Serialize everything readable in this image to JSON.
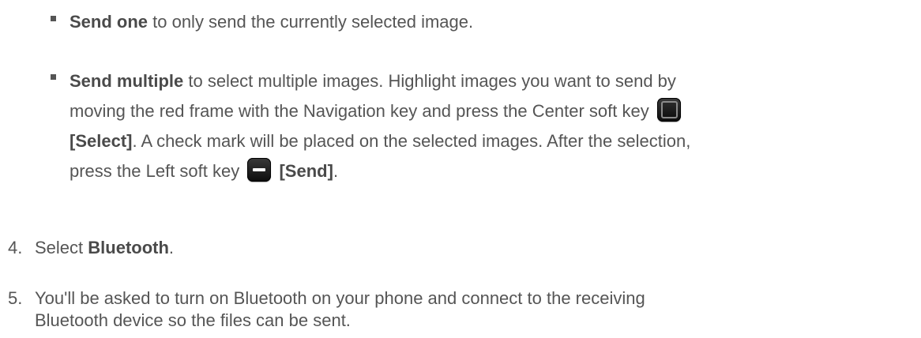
{
  "bullets": [
    {
      "bold": "Send one",
      "text": " to only send the currently selected image."
    },
    {
      "bold": "Send multiple",
      "line1": " to select multiple images. Highlight images you want to send by",
      "line2": "moving the red frame with the Navigation key and press the Center soft key",
      "select_label": "[Select]",
      "line3": ". A check mark will be placed on the selected images. After the selection,",
      "line4": "press the Left soft key",
      "send_label": "[Send]",
      "end": "."
    }
  ],
  "steps": [
    {
      "num": "4.",
      "pre": "Select ",
      "bold": "Bluetooth",
      "post": "."
    },
    {
      "num": "5.",
      "line1": "You'll be asked to turn on Bluetooth on your phone and connect to the receiving",
      "line2": "Bluetooth device so the files can be sent."
    }
  ],
  "icons": {
    "center_key": "center-soft-key-icon",
    "left_key": "left-soft-key-icon"
  }
}
